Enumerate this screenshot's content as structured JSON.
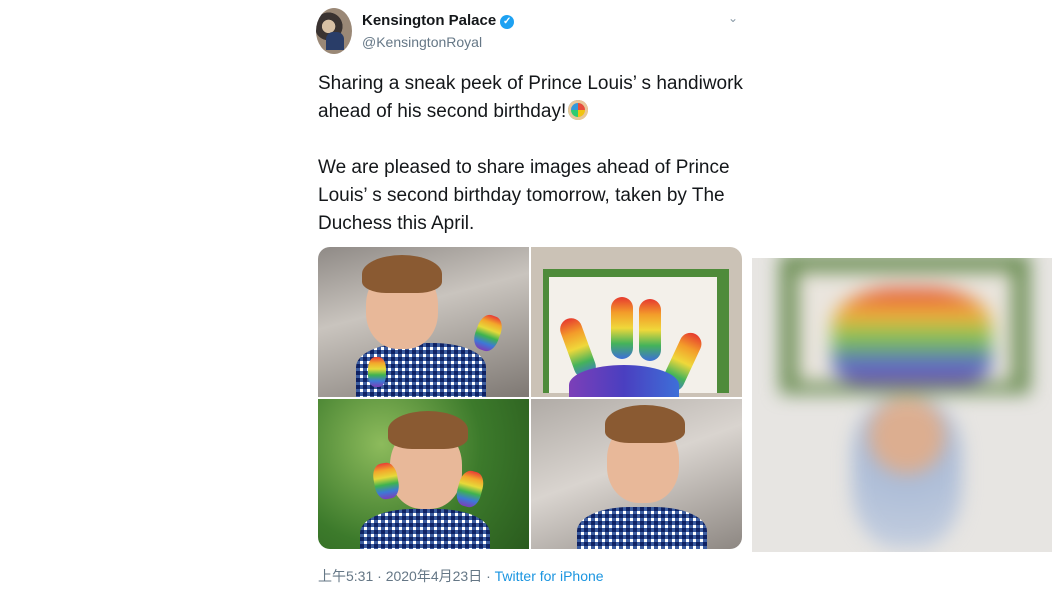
{
  "tweet": {
    "author_name": "Kensington Palace",
    "verified_glyph": "✓",
    "handle": "@KensingtonRoyal",
    "chevron": "⌄",
    "text_line1": "Sharing a sneak peek of Prince Louis’ s handiwork",
    "text_line2": "ahead of his second birthday!",
    "text_line3": "We are pleased to share images ahead of Prince",
    "text_line4": "Louis’ s second birthday tomorrow, taken by The",
    "text_line5": "Duchess this April.",
    "meta_time": "上午5:31 · 2020年4月23日 · ",
    "meta_source": "Twitter for iPhone"
  },
  "colors": {
    "link": "#1b95e0",
    "verified": "#1da1f2",
    "text": "#14171a",
    "secondary": "#657786"
  },
  "icons": {
    "verified": "verified-badge-icon",
    "chevron": "chevron-down-icon",
    "palette": "artist-palette-emoji"
  }
}
